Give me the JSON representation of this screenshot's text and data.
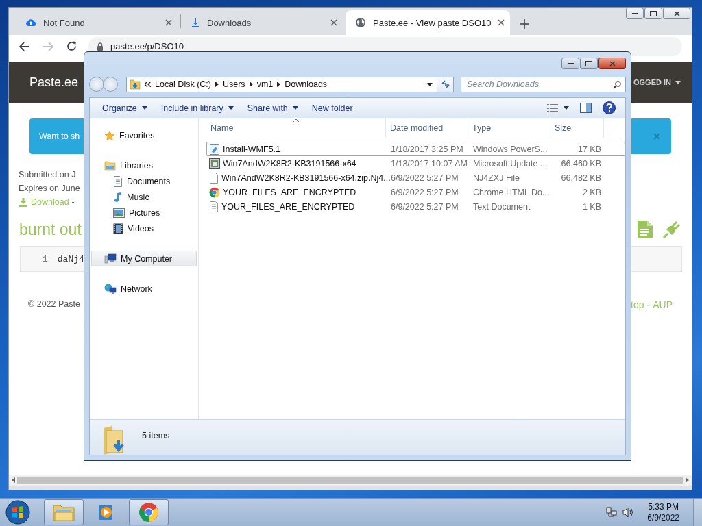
{
  "browser": {
    "tabs": [
      {
        "title": "Not Found",
        "kind": "cloud",
        "selected": false
      },
      {
        "title": "Downloads",
        "kind": "download",
        "selected": false
      },
      {
        "title": "Paste.ee - View paste DSO10",
        "kind": "globe",
        "selected": true
      }
    ],
    "forward_disabled": true,
    "address": "paste.ee/p/DSO10",
    "page": {
      "brand": "Paste.ee",
      "account": "OGGED IN",
      "alert": "Want to sh",
      "submitted": "Submitted on J",
      "expires": "Expires on June",
      "download": "Download",
      "download_sep": "-",
      "title": "burnt out",
      "code_lines": [
        {
          "number": "1",
          "text": "daNj4"
        }
      ],
      "footer_left": "© 2022 Paste",
      "footer_links": [
        {
          "text": "top",
          "kind": "link"
        },
        {
          "text": "-",
          "kind": "sep"
        },
        {
          "text": "AUP",
          "kind": "link"
        }
      ]
    }
  },
  "explorer": {
    "breadcrumb": [
      "Local Disk (C:)",
      "Users",
      "vm1",
      "Downloads"
    ],
    "search": {
      "placeholder": "Search Downloads"
    },
    "commands": [
      {
        "label": "Organize",
        "dropdown": true
      },
      {
        "label": "Include in library",
        "dropdown": true
      },
      {
        "label": "Share with",
        "dropdown": true
      },
      {
        "label": "New folder",
        "dropdown": false
      }
    ],
    "nav": [
      {
        "label": "Favorites",
        "kind": "star",
        "selected": false
      },
      {
        "label": "Libraries",
        "kind": "library",
        "selected": false,
        "children": [
          {
            "label": "Documents",
            "kind": "document",
            "selected": false
          },
          {
            "label": "Music",
            "kind": "music",
            "selected": false
          },
          {
            "label": "Pictures",
            "kind": "pictures",
            "selected": false
          },
          {
            "label": "Videos",
            "kind": "videos",
            "selected": false
          }
        ]
      },
      {
        "label": "My Computer",
        "kind": "computer",
        "selected": true
      },
      {
        "label": "Network",
        "kind": "network",
        "selected": false
      }
    ],
    "columns": [
      {
        "label": "Name",
        "sorted": true
      },
      {
        "label": "Date modified",
        "sorted": false
      },
      {
        "label": "Type",
        "sorted": false
      },
      {
        "label": "Size",
        "sorted": false
      }
    ],
    "rows": [
      {
        "name": "Install-WMF5.1",
        "date": "1/18/2017 3:25 PM",
        "type": "Windows PowerS...",
        "size": "17 KB",
        "kind": "script",
        "focused": true
      },
      {
        "name": "Win7AndW2K8R2-KB3191566-x64",
        "date": "1/13/2017 10:07 AM",
        "type": "Microsoft Update ...",
        "size": "66,460 KB",
        "kind": "update",
        "focused": false
      },
      {
        "name": "Win7AndW2K8R2-KB3191566-x64.zip.Nj4...",
        "date": "6/9/2022 5:27 PM",
        "type": "NJ4ZXJ File",
        "size": "66,482 KB",
        "kind": "file",
        "focused": false
      },
      {
        "name": "YOUR_FILES_ARE_ENCRYPTED",
        "date": "6/9/2022 5:27 PM",
        "type": "Chrome HTML Do...",
        "size": "2 KB",
        "kind": "chrome",
        "focused": false
      },
      {
        "name": "YOUR_FILES_ARE_ENCRYPTED",
        "date": "6/9/2022 5:27 PM",
        "type": "Text Document",
        "size": "1 KB",
        "kind": "text",
        "focused": false
      }
    ],
    "status": "5 items"
  },
  "taskbar": {
    "apps": [
      {
        "kind": "explorer",
        "running": true
      },
      {
        "kind": "media",
        "running": false
      },
      {
        "kind": "chrome",
        "running": true
      }
    ],
    "time": "5:33 PM",
    "date": "6/9/2022"
  }
}
